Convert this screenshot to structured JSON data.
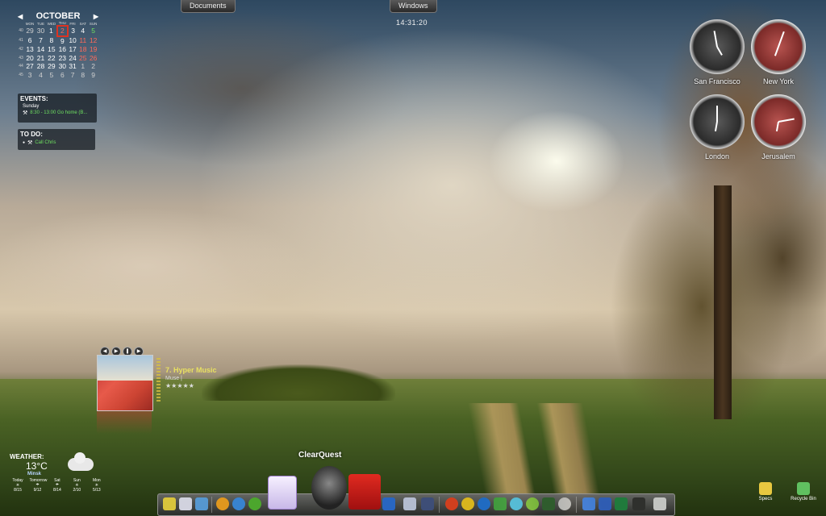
{
  "top_tabs": {
    "documents": "Documents",
    "windows": "Windows"
  },
  "digital_clock": "14:31:20",
  "calendar": {
    "month": "OCTOBER",
    "prev": "◀",
    "next": "▶",
    "weekdays": [
      "MON",
      "TUE",
      "WED",
      "THU",
      "FRI",
      "SAT",
      "SUN"
    ],
    "weeks": [
      {
        "wk": "40",
        "days": [
          "29",
          "30",
          "1",
          "2",
          "3",
          "4",
          "5"
        ]
      },
      {
        "wk": "41",
        "days": [
          "6",
          "7",
          "8",
          "9",
          "10",
          "11",
          "12"
        ]
      },
      {
        "wk": "42",
        "days": [
          "13",
          "14",
          "15",
          "16",
          "17",
          "18",
          "19"
        ]
      },
      {
        "wk": "43",
        "days": [
          "20",
          "21",
          "22",
          "23",
          "24",
          "25",
          "26"
        ]
      },
      {
        "wk": "44",
        "days": [
          "27",
          "28",
          "29",
          "30",
          "31",
          "1",
          "2"
        ]
      },
      {
        "wk": "45",
        "days": [
          "3",
          "4",
          "5",
          "6",
          "7",
          "8",
          "9"
        ]
      }
    ]
  },
  "events": {
    "title": "EVENTS:",
    "day": "Sunday",
    "item": "8:30 - 13:00 Go home (B..."
  },
  "todo": {
    "title": "TO DO:",
    "item": "Call Chris"
  },
  "world_clocks": [
    {
      "city": "San Francisco"
    },
    {
      "city": "New York"
    },
    {
      "city": "London"
    },
    {
      "city": "Jerusalem"
    }
  ],
  "music": {
    "track": "7. Hyper Music",
    "artist": "Muse |",
    "rating": "★★★★★"
  },
  "weather": {
    "title": "WEATHER:",
    "temp": "13°C",
    "city": "Minsk",
    "forecast": [
      {
        "day": "Today",
        "temps": "8/15"
      },
      {
        "day": "Tomorrow",
        "temps": "9/12"
      },
      {
        "day": "Sat",
        "temps": "8/14"
      },
      {
        "day": "Sun",
        "temps": "2/10"
      },
      {
        "day": "Mon",
        "temps": "5/13"
      }
    ]
  },
  "dock": {
    "hover_label": "ClearQuest"
  },
  "desktop_icons": {
    "specs": "Specs",
    "recycle_bin": "Recycle Bin"
  }
}
